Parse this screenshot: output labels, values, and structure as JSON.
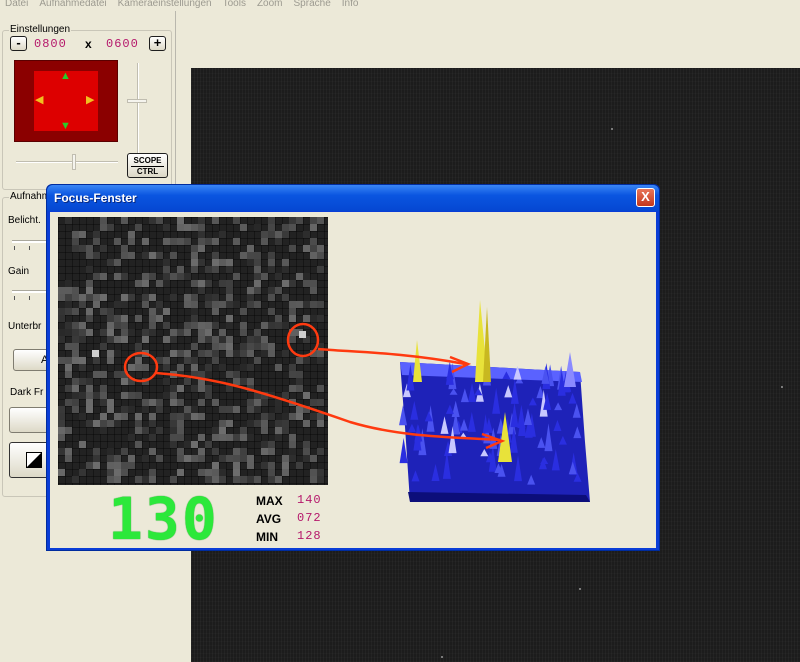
{
  "menu": [
    "Datei",
    "Aufnahmedatei",
    "Kameraeinstellungen",
    "Tools",
    "Zoom",
    "Sprache",
    "Info"
  ],
  "settings": {
    "title": "Einstellungen",
    "minus": "-",
    "plus": "+",
    "width": "0800",
    "x": "x",
    "height": "0600",
    "scope_line1": "SCOPE",
    "scope_line2": "CTRL"
  },
  "capture": {
    "title": "Aufnahm",
    "exposure_label": "Belicht.",
    "gain_label": "Gain",
    "interrupt_label": "Unterbr",
    "button_a": "A",
    "dark_frame_label": "Dark Fr"
  },
  "focus_window": {
    "title": "Focus-Fenster",
    "close": "X",
    "value": "130",
    "max_label": "MAX",
    "max_value": "140",
    "avg_label": "AVG",
    "avg_value": "072",
    "min_label": "MIN",
    "min_value": "128"
  },
  "icons": {
    "arrow_up": "▲",
    "arrow_down": "▼",
    "arrow_left": "◀",
    "arrow_right": "▶"
  },
  "colors": {
    "lcd": "#2ce83a",
    "value_text": "#b5186b",
    "roi_inner": "#dd0000",
    "roi_outer": "#8b0000",
    "annotation": "#ff3a10",
    "surface_blue": "#2a2ee0",
    "surface_peak": "#e8e23a"
  }
}
